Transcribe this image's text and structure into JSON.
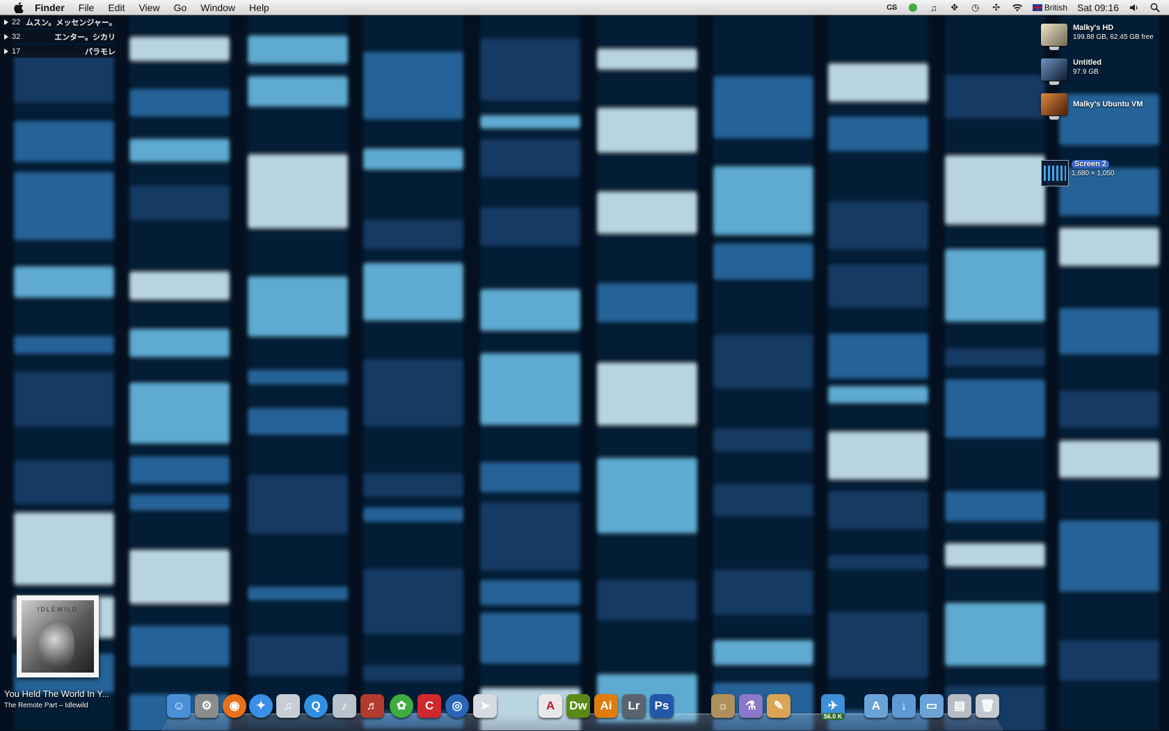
{
  "menubar": {
    "app_name": "Finder",
    "menus": [
      "File",
      "Edit",
      "View",
      "Go",
      "Window",
      "Help"
    ],
    "status": {
      "input_source": "British",
      "clock": "Sat 09:16"
    }
  },
  "feeds": [
    {
      "count": "22",
      "title": "ムスン。メッセンジャー。"
    },
    {
      "count": "32",
      "title": "エンター。シカリ"
    },
    {
      "count": "17",
      "title": "パラモレ"
    }
  ],
  "desktop": {
    "volumes": [
      {
        "name": "Malky's HD",
        "info": "199.88 GB, 62.45 GB free",
        "color": "#c9c2a8"
      },
      {
        "name": "Untitled",
        "info": "97.9 GB",
        "color": "#2c4a6e"
      },
      {
        "name": "Malky's Ubuntu VM",
        "info": "",
        "color": "#a0521e"
      }
    ],
    "screen": {
      "name": "Screen 2",
      "info": "1,680 × 1,050"
    }
  },
  "now_playing": {
    "album_band": "IDLEWILD",
    "title": "You Held The World In Y...",
    "subtitle": "The Remote Part – Idlewild"
  },
  "dock": {
    "badge": "56.0 K",
    "apps": [
      {
        "name": "finder-icon",
        "glyph": "☺",
        "color": "#4a90d9"
      },
      {
        "name": "system-preferences-icon",
        "glyph": "⚙",
        "color": "#8c8c8c"
      },
      {
        "name": "firefox-icon",
        "glyph": "◉",
        "color": "#e8701a"
      },
      {
        "name": "safari-icon",
        "glyph": "✦",
        "color": "#3a8ee6"
      },
      {
        "name": "itunes-icon",
        "glyph": "♫",
        "color": "#c8ccd4"
      },
      {
        "name": "quicktime-icon",
        "glyph": "Q",
        "color": "#2f8fe0"
      },
      {
        "name": "guitar-icon",
        "glyph": "♪",
        "color": "#b9c2cc"
      },
      {
        "name": "garageband-icon",
        "glyph": "♬",
        "color": "#b23a2e"
      },
      {
        "name": "adium-duck-icon",
        "glyph": "✿",
        "color": "#3fae3f"
      },
      {
        "name": "app-c-icon",
        "glyph": "C",
        "color": "#d0282f"
      },
      {
        "name": "google-earth-icon",
        "glyph": "◎",
        "color": "#2a66b8"
      },
      {
        "name": "paper-plane-icon",
        "glyph": "➤",
        "color": "#d6dbe2"
      },
      {
        "name": "acrobat-icon",
        "glyph": "A",
        "color": "#e9e9e9"
      },
      {
        "name": "dreamweaver-icon",
        "glyph": "Dw",
        "color": "#5a8a16"
      },
      {
        "name": "illustrator-icon",
        "glyph": "Ai",
        "color": "#e07b0c"
      },
      {
        "name": "lightroom-icon",
        "glyph": "Lr",
        "color": "#5a6470"
      },
      {
        "name": "photoshop-icon",
        "glyph": "Ps",
        "color": "#2357a8"
      },
      {
        "name": "photo-app-icon",
        "glyph": "☼",
        "color": "#b0905a"
      },
      {
        "name": "potion-icon",
        "glyph": "⚗",
        "color": "#8a78c8"
      },
      {
        "name": "sign-icon",
        "glyph": "✎",
        "color": "#d9a455"
      },
      {
        "name": "twitter-bird-icon",
        "glyph": "✈",
        "color": "#3c8fd8"
      },
      {
        "name": "applications-folder-icon",
        "glyph": "A",
        "color": "#6aa3d8"
      },
      {
        "name": "downloads-folder-icon",
        "glyph": "↓",
        "color": "#5f9ad6"
      },
      {
        "name": "documents-folder-icon",
        "glyph": "▭",
        "color": "#6aa3d8"
      },
      {
        "name": "preview-icon",
        "glyph": "▤",
        "color": "#b8bcc4"
      },
      {
        "name": "trash-icon",
        "glyph": "🗑",
        "color": "#c4c8cf"
      }
    ]
  }
}
